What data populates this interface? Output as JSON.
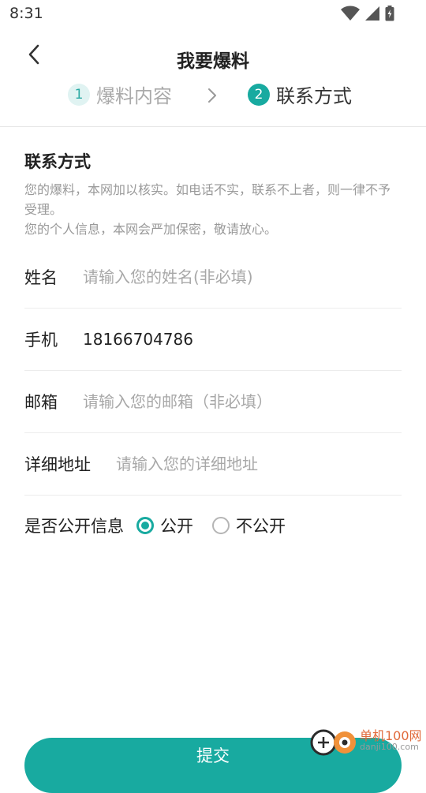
{
  "status": {
    "time": "8:31",
    "icons": [
      "wifi-icon",
      "signal-icon",
      "battery-icon"
    ]
  },
  "header": {
    "title": "我要爆料",
    "back_icon": "chevron-left-icon"
  },
  "steps": [
    {
      "num": "1",
      "label": "爆料内容"
    },
    {
      "num": "2",
      "label": "联系方式"
    }
  ],
  "section": {
    "title": "联系方式",
    "notice": "您的爆料，本网加以核实。如电话不实，联系不上者，则一律不予受理。\n您的个人信息，本网会严加保密，敬请放心。"
  },
  "form": {
    "name": {
      "label": "姓名",
      "value": "",
      "placeholder": "请输入您的姓名(非必填)"
    },
    "phone": {
      "label": "手机",
      "value": "18166704786",
      "placeholder": ""
    },
    "email": {
      "label": "邮箱",
      "value": "",
      "placeholder": "请输入您的邮箱（非必填）"
    },
    "address": {
      "label": "详细地址",
      "value": "",
      "placeholder": "请输入您的详细地址"
    },
    "public": {
      "label": "是否公开信息",
      "options": [
        "公开",
        "不公开"
      ],
      "selected": "公开"
    }
  },
  "submit_label": "提交",
  "watermark": {
    "text": "单机100网",
    "sub": "danji100.com"
  },
  "colors": {
    "accent": "#18aaa0",
    "step_inactive_bg": "#e0f3f2",
    "placeholder": "#a8a8a8"
  }
}
